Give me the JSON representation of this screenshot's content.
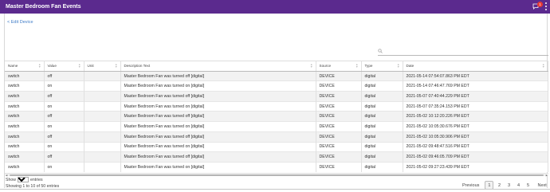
{
  "header": {
    "title": "Master Bedroom Fan Events",
    "notification_count": "1"
  },
  "nav": {
    "back_label": "< Edit Device"
  },
  "search": {
    "placeholder": ""
  },
  "table": {
    "columns": [
      "Name",
      "Value",
      "Unit",
      "Description Text",
      "Source",
      "Type",
      "Date"
    ],
    "rows": [
      {
        "name": "switch",
        "value": "off",
        "unit": "",
        "description": "Master Bedroom Fan was turned off [digital]",
        "source": "DEVICE",
        "type": "digital",
        "date": "2021-05-14 07:54:07.863 PM EDT"
      },
      {
        "name": "switch",
        "value": "on",
        "unit": "",
        "description": "Master Bedroom Fan was turned on [digital]",
        "source": "DEVICE",
        "type": "digital",
        "date": "2021-05-14 07:46:47.769 PM EDT"
      },
      {
        "name": "switch",
        "value": "off",
        "unit": "",
        "description": "Master Bedroom Fan was turned off [digital]",
        "source": "DEVICE",
        "type": "digital",
        "date": "2021-05-07 07:40:44.229 PM EDT"
      },
      {
        "name": "switch",
        "value": "on",
        "unit": "",
        "description": "Master Bedroom Fan was turned on [digital]",
        "source": "DEVICE",
        "type": "digital",
        "date": "2021-05-07 07:35:24.153 PM EDT"
      },
      {
        "name": "switch",
        "value": "off",
        "unit": "",
        "description": "Master Bedroom Fan was turned off [digital]",
        "source": "DEVICE",
        "type": "digital",
        "date": "2021-05-02 10:12:20.226 PM EDT"
      },
      {
        "name": "switch",
        "value": "on",
        "unit": "",
        "description": "Master Bedroom Fan was turned on [digital]",
        "source": "DEVICE",
        "type": "digital",
        "date": "2021-05-02 10:05:30.676 PM EDT"
      },
      {
        "name": "switch",
        "value": "off",
        "unit": "",
        "description": "Master Bedroom Fan was turned off [digital]",
        "source": "DEVICE",
        "type": "digital",
        "date": "2021-05-02 10:05:30.906 PM EDT"
      },
      {
        "name": "switch",
        "value": "on",
        "unit": "",
        "description": "Master Bedroom Fan was turned on [digital]",
        "source": "DEVICE",
        "type": "digital",
        "date": "2021-05-02 09:48:47.516 PM EDT"
      },
      {
        "name": "switch",
        "value": "off",
        "unit": "",
        "description": "Master Bedroom Fan was turned off [digital]",
        "source": "DEVICE",
        "type": "digital",
        "date": "2021-05-02 09:46:05.709 PM EDT"
      },
      {
        "name": "switch",
        "value": "on",
        "unit": "",
        "description": "Master Bedroom Fan was turned on [digital]",
        "source": "DEVICE",
        "type": "digital",
        "date": "2021-05-02 09:27:23.439 PM EDT"
      }
    ]
  },
  "footer": {
    "show_label": "Show",
    "page_size": "10",
    "entries_label": "entries",
    "info": "Showing 1 to 10 of 50 entries"
  },
  "pagination": {
    "previous": "Previous",
    "pages": [
      "1",
      "2",
      "3",
      "4",
      "5"
    ],
    "next": "Next",
    "current": "1"
  },
  "colors": {
    "header_bg": "#5b2a8e",
    "link": "#3f7cc7",
    "badge": "#e53935"
  }
}
